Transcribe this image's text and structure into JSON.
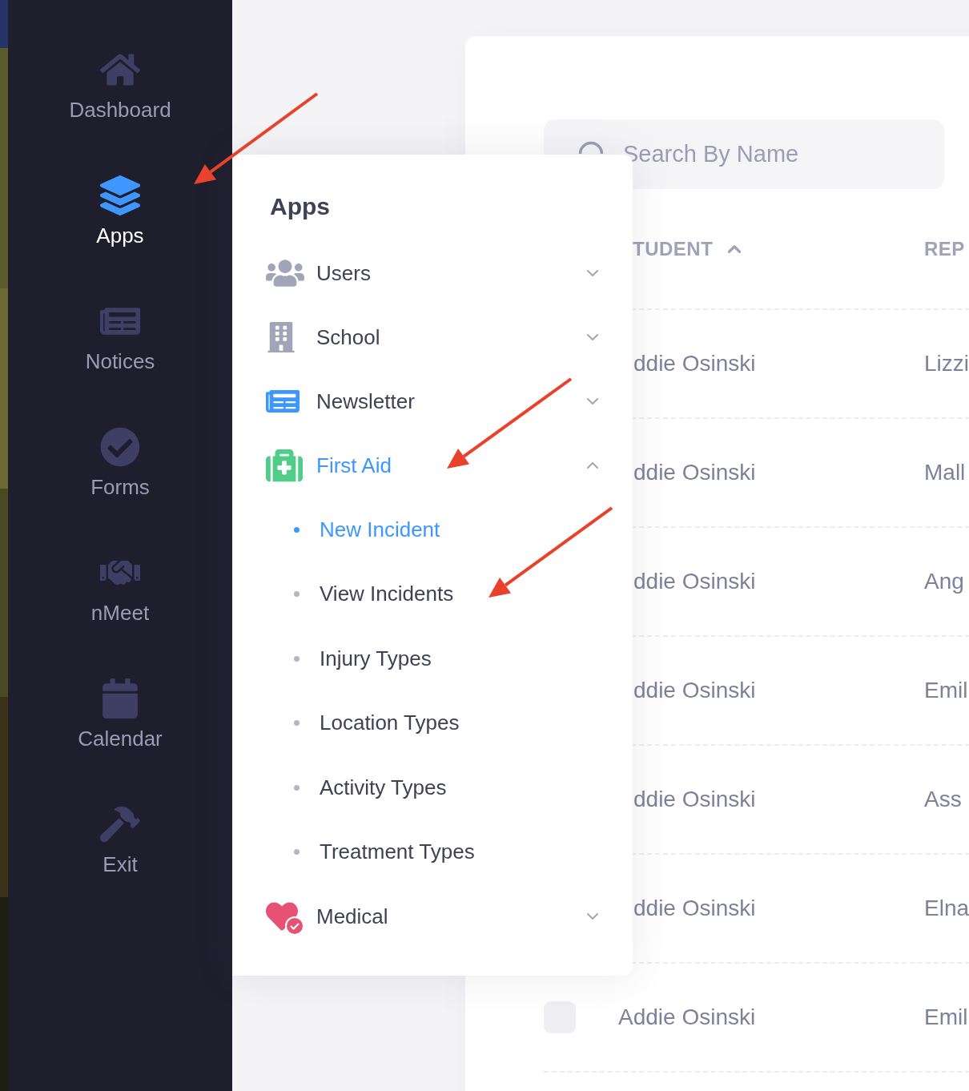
{
  "sidebar": {
    "items": [
      {
        "label": "Dashboard",
        "selected": false
      },
      {
        "label": "Apps",
        "selected": true
      },
      {
        "label": "Notices",
        "selected": false
      },
      {
        "label": "Forms",
        "selected": false
      },
      {
        "label": "nMeet",
        "selected": false
      },
      {
        "label": "Calendar",
        "selected": false
      },
      {
        "label": "Exit",
        "selected": false
      }
    ]
  },
  "apps_menu": {
    "title": "Apps",
    "items": [
      {
        "label": "Users",
        "expanded": false,
        "selected": false
      },
      {
        "label": "School",
        "expanded": false,
        "selected": false
      },
      {
        "label": "Newsletter",
        "expanded": false,
        "selected": false
      },
      {
        "label": "First Aid",
        "expanded": true,
        "selected": true,
        "children": [
          {
            "label": "New Incident",
            "selected": true
          },
          {
            "label": "View Incidents",
            "selected": false
          },
          {
            "label": "Injury Types",
            "selected": false
          },
          {
            "label": "Location Types",
            "selected": false
          },
          {
            "label": "Activity Types",
            "selected": false
          },
          {
            "label": "Treatment Types",
            "selected": false
          }
        ]
      },
      {
        "label": "Medical",
        "expanded": false,
        "selected": false
      }
    ]
  },
  "search": {
    "placeholder": "Search By Name"
  },
  "table": {
    "columns": [
      {
        "label": "TUDENT",
        "sorted_ascending": true
      },
      {
        "label": "REP"
      }
    ],
    "rows": [
      {
        "cells": [
          "ddie Osinski",
          "Lizzi"
        ]
      },
      {
        "cells": [
          "ddie Osinski",
          "Mall"
        ]
      },
      {
        "cells": [
          "ddie Osinski",
          "Ang"
        ]
      },
      {
        "cells": [
          "ddie Osinski",
          "Emil"
        ]
      },
      {
        "cells": [
          "ddie Osinski",
          "Ass"
        ]
      },
      {
        "cells": [
          "ddie Osinski",
          "Elna"
        ]
      },
      {
        "cells": [
          "Addie Osinski",
          "Emil"
        ],
        "checked": false
      }
    ]
  }
}
